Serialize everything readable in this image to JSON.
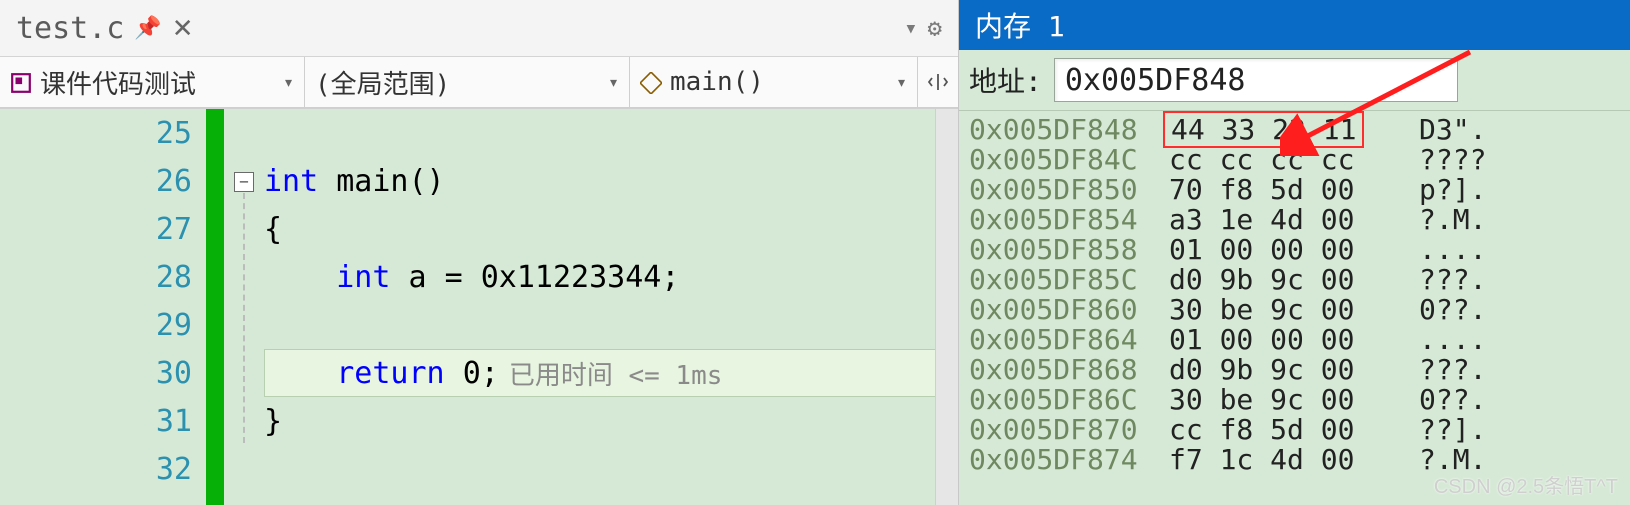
{
  "tab": {
    "filename": "test.c",
    "pin_icon": "⟂",
    "close_icon": "✕"
  },
  "nav": {
    "scope1": "课件代码测试",
    "scope2": "(全局范围)",
    "scope3": "main()"
  },
  "code": {
    "lines": [
      {
        "n": "25",
        "text": ""
      },
      {
        "n": "26",
        "text": "int main()"
      },
      {
        "n": "27",
        "text": "{"
      },
      {
        "n": "28",
        "text": "    int a = 0x11223344;"
      },
      {
        "n": "29",
        "text": ""
      },
      {
        "n": "30",
        "text": "    return 0;"
      },
      {
        "n": "31",
        "text": "}"
      },
      {
        "n": "32",
        "text": ""
      }
    ],
    "perf_hint": "已用时间 <= 1ms",
    "current_line_index": 5
  },
  "memory": {
    "title": "内存 1",
    "addr_label": "地址:",
    "addr_value": "0x005DF848",
    "rows": [
      {
        "addr": "0x005DF848",
        "bytes": "44 33 22 11",
        "ascii": "D3\".",
        "highlight": true
      },
      {
        "addr": "0x005DF84C",
        "bytes": "cc cc cc cc",
        "ascii": "????"
      },
      {
        "addr": "0x005DF850",
        "bytes": "70 f8 5d 00",
        "ascii": "p?]."
      },
      {
        "addr": "0x005DF854",
        "bytes": "a3 1e 4d 00",
        "ascii": "?.M."
      },
      {
        "addr": "0x005DF858",
        "bytes": "01 00 00 00",
        "ascii": "...."
      },
      {
        "addr": "0x005DF85C",
        "bytes": "d0 9b 9c 00",
        "ascii": "???."
      },
      {
        "addr": "0x005DF860",
        "bytes": "30 be 9c 00",
        "ascii": "0??."
      },
      {
        "addr": "0x005DF864",
        "bytes": "01 00 00 00",
        "ascii": "...."
      },
      {
        "addr": "0x005DF868",
        "bytes": "d0 9b 9c 00",
        "ascii": "???."
      },
      {
        "addr": "0x005DF86C",
        "bytes": "30 be 9c 00",
        "ascii": "0??."
      },
      {
        "addr": "0x005DF870",
        "bytes": "cc f8 5d 00",
        "ascii": "??]."
      },
      {
        "addr": "0x005DF874",
        "bytes": "f7 1c 4d 00",
        "ascii": "?.M."
      }
    ]
  },
  "watermark": "CSDN @2.5条悟T^T"
}
